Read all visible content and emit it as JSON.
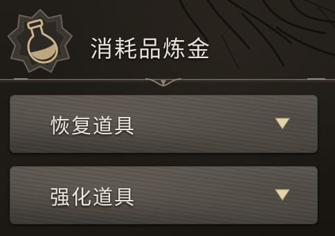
{
  "header": {
    "title": "消耗品炼金",
    "badge_icon": "potion-flask-icon"
  },
  "categories": [
    {
      "label": "恢复道具",
      "icon": "chevron-down-icon"
    },
    {
      "label": "强化道具",
      "icon": "chevron-down-icon"
    }
  ],
  "colors": {
    "background": "#1d1914",
    "row_stone": "#4a4540",
    "text": "#ece6dc",
    "chevron": "#e2d2a8",
    "flask_gold": "#cdb58a"
  }
}
